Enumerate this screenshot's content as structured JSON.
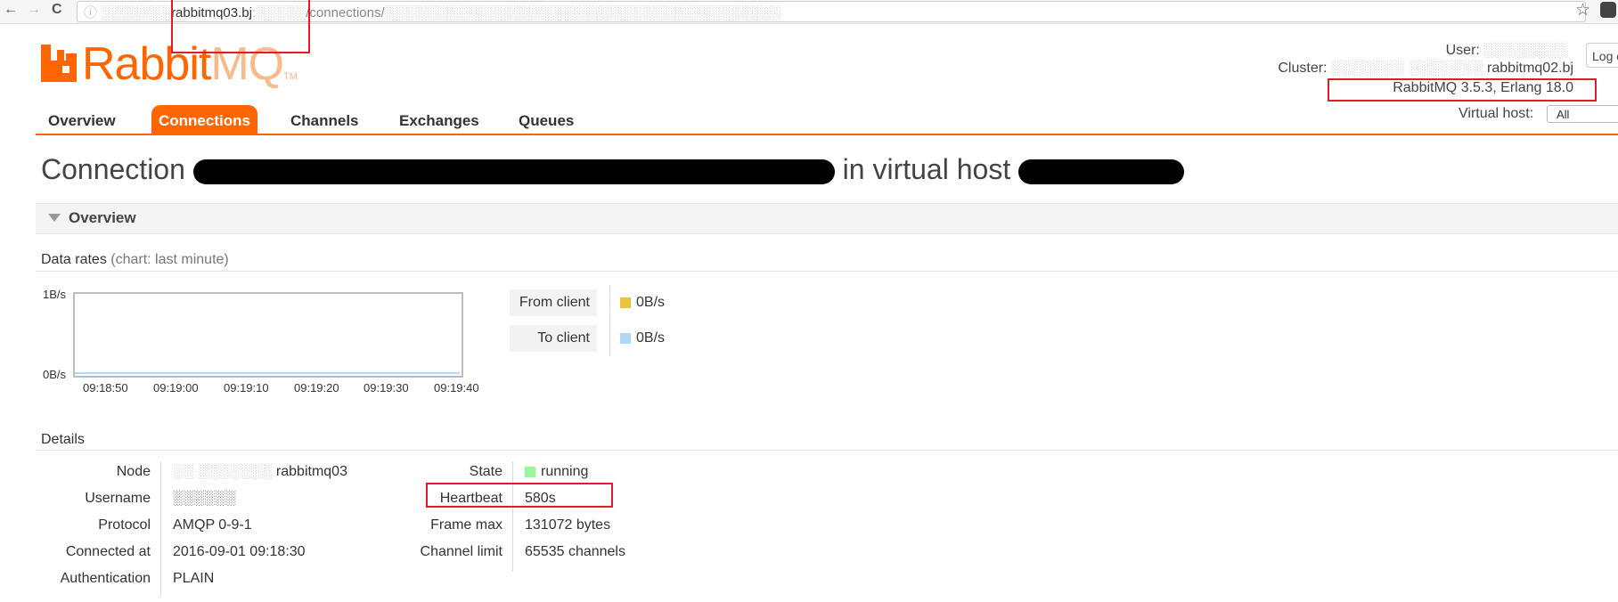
{
  "browser": {
    "back_glyph": "←",
    "forward_glyph": "→",
    "reload_glyph": "C",
    "url_prefix": "ⓘ ░░░░░░░",
    "url_host": "rabbitmq03.bj",
    "url_port": ":░░░░░",
    "url_path": "/connections/",
    "url_tail": "░░░░░░░░░░░░░░░░░░░░░░░░░░░░░░░░░░░░░░░░",
    "star_glyph": "☆"
  },
  "logo": {
    "rabbit": "Rabbit",
    "mq": "MQ",
    "tm": "TM"
  },
  "header": {
    "user_label": "User:",
    "user_value": "░░░░░░░░",
    "logout_label": "Log out",
    "cluster_label": "Cluster:",
    "cluster_value_blur": "░░░░░░░ ░░░░░░░",
    "cluster_value": "rabbitmq02.bj",
    "version": "RabbitMQ 3.5.3, Erlang 18.0",
    "vhost_label": "Virtual host:",
    "vhost_value": "All"
  },
  "tabs": [
    {
      "label": "Overview"
    },
    {
      "label": "Connections"
    },
    {
      "label": "Channels"
    },
    {
      "label": "Exchanges"
    },
    {
      "label": "Queues"
    }
  ],
  "title": {
    "prefix": "Connection",
    "middle": "in virtual host"
  },
  "section": {
    "title": "Overview"
  },
  "data_rates": {
    "heading": "Data rates",
    "hint": "(chart: last minute)",
    "y_top": "1B/s",
    "y_bottom": "0B/s",
    "x_ticks": [
      "09:18:50",
      "09:19:00",
      "09:19:10",
      "09:19:20",
      "09:19:30",
      "09:19:40"
    ],
    "from_client_label": "From client",
    "from_client_value": "0B/s",
    "from_client_color": "#edc240",
    "to_client_label": "To client",
    "to_client_value": "0B/s",
    "to_client_color": "#afd8f8"
  },
  "details": {
    "heading": "Details",
    "node_label": "Node",
    "node_value_blur": "░░ ░░░░░░░",
    "node_value": "rabbitmq03",
    "username_label": "Username",
    "username_value": "░░░░░░",
    "protocol_label": "Protocol",
    "protocol_value": "AMQP 0-9-1",
    "connected_label": "Connected at",
    "connected_value": "2016-09-01 09:18:30",
    "auth_label": "Authentication",
    "auth_value": "PLAIN",
    "state_label": "State",
    "state_value": "running",
    "state_color": "#98f898",
    "heartbeat_label": "Heartbeat",
    "heartbeat_value": "580s",
    "framemax_label": "Frame max",
    "framemax_value": "131072 bytes",
    "chanlimit_label": "Channel limit",
    "chanlimit_value": "65535 channels"
  },
  "colors": {
    "brand": "#ff6600",
    "annotation": "#e21b2a"
  }
}
